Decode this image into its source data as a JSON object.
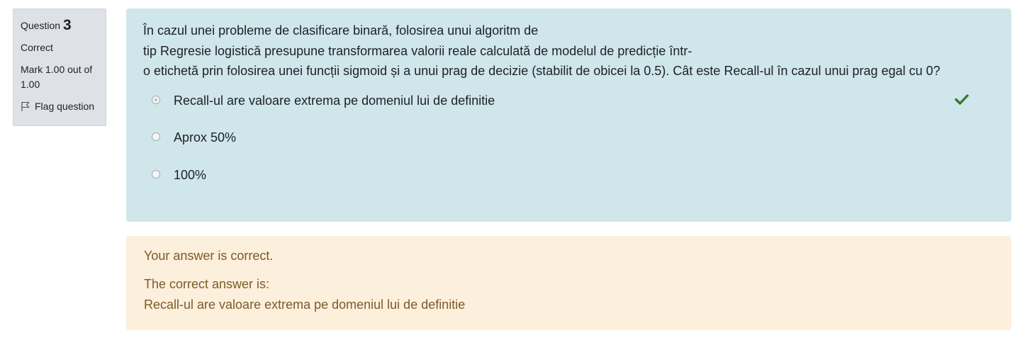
{
  "info": {
    "question_prefix": "Question",
    "question_number": "3",
    "state": "Correct",
    "grade": "Mark 1.00 out of 1.00",
    "flag_label": "Flag question",
    "flag_icon": "flag-outline-icon"
  },
  "question": {
    "text_lines": [
      "În cazul unei probleme de clasificare binară, folosirea unui algoritm de",
      "tip Regresie logistică presupune transformarea valorii reale calculată de modelul de predicție într-",
      "o etichetă prin folosirea unei funcții sigmoid și a unui prag de decizie (stabilit de obicei la 0.5). Cât este Recall-ul în cazul unui prag egal cu 0?"
    ],
    "options": [
      {
        "label": "Recall-ul are valoare extrema pe domeniul lui de definitie",
        "selected": true,
        "correct": true
      },
      {
        "label": "Aprox 50%",
        "selected": false,
        "correct": false
      },
      {
        "label": "100%",
        "selected": false,
        "correct": false
      }
    ],
    "correct_icon": "checkmark-icon",
    "correct_color": "#357a32"
  },
  "outcome": {
    "feedback": "Your answer is correct.",
    "right_answer_heading": "The correct answer is:",
    "right_answer": "Recall-ul are valoare extrema pe domeniul lui de definitie"
  },
  "colors": {
    "info_bg": "#dee2e6",
    "formulation_bg": "#cfe6eb",
    "outcome_bg": "#fcefdc",
    "outcome_text": "#7d5a29"
  }
}
